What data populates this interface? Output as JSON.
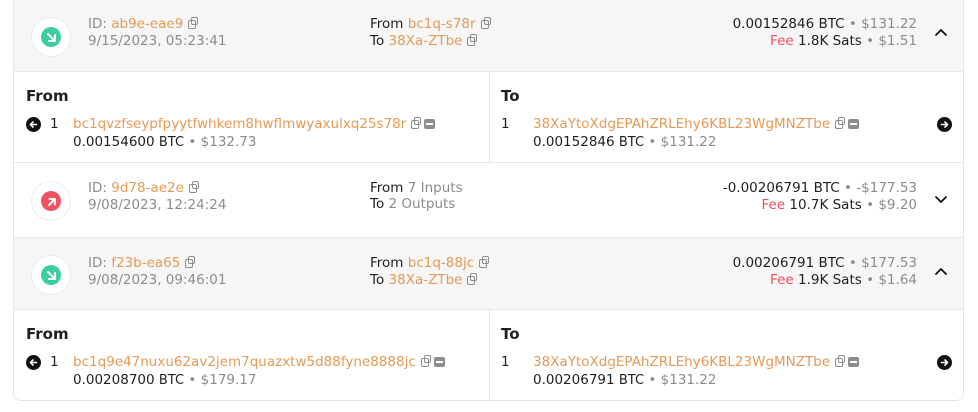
{
  "transactions": [
    {
      "id_label": "ID:",
      "id": "ab9e-eae9",
      "date": "9/15/2023, 05:23:41",
      "direction": "incoming",
      "from_label": "From",
      "from": "bc1q-s78r",
      "to_label": "To",
      "to": "38Xa-ZTbe",
      "amount": "0.00152846 BTC",
      "amount_usd": "$131.22",
      "fee_label": "Fee",
      "fee_sats": "1.8K Sats",
      "fee_usd": "$1.51",
      "expanded": true,
      "detail": {
        "from_heading": "From",
        "to_heading": "To",
        "inputs": [
          {
            "index": "1",
            "address": "bc1qvzfseypfpyytfwhkem8hwflmwyaxulxq25s78r",
            "btc": "0.00154600",
            "unit": "BTC",
            "usd": "$132.73"
          }
        ],
        "outputs": [
          {
            "index": "1",
            "address": "38XaYtoXdgEPAhZRLEhy6KBL23WgMNZTbe",
            "btc": "0.00152846",
            "unit": "BTC",
            "usd": "$131.22"
          }
        ]
      }
    },
    {
      "id_label": "ID:",
      "id": "9d78-ae2e",
      "date": "9/08/2023, 12:24:24",
      "direction": "outgoing",
      "from_label": "From",
      "from": "7 Inputs",
      "to_label": "To",
      "to": "2 Outputs",
      "amount": "-0.00206791 BTC",
      "amount_usd": "-$177.53",
      "fee_label": "Fee",
      "fee_sats": "10.7K Sats",
      "fee_usd": "$9.20",
      "expanded": false
    },
    {
      "id_label": "ID:",
      "id": "f23b-ea65",
      "date": "9/08/2023, 09:46:01",
      "direction": "incoming",
      "from_label": "From",
      "from": "bc1q-88jc",
      "to_label": "To",
      "to": "38Xa-ZTbe",
      "amount": "0.00206791 BTC",
      "amount_usd": "$177.53",
      "fee_label": "Fee",
      "fee_sats": "1.9K Sats",
      "fee_usd": "$1.64",
      "expanded": true,
      "detail": {
        "from_heading": "From",
        "to_heading": "To",
        "inputs": [
          {
            "index": "1",
            "address": "bc1q9e47nuxu62av2jem7quazxtw5d88fyne8888jc",
            "btc": "0.00208700",
            "unit": "BTC",
            "usd": "$179.17"
          }
        ],
        "outputs": [
          {
            "index": "1",
            "address": "38XaYtoXdgEPAhZRLEhy6KBL23WgMNZTbe",
            "btc": "0.00206791",
            "unit": "BTC",
            "usd": "$131.22"
          }
        ]
      }
    }
  ],
  "colors": {
    "incoming": "#3ccf9b",
    "outgoing": "#ef5263",
    "link": "#e59a55",
    "fee": "#ef4e5e"
  },
  "icons": [
    "arrow-in-icon",
    "arrow-out-icon",
    "copy-icon",
    "wallet-icon",
    "chevron-up-icon",
    "chevron-down-icon",
    "arrow-left-circle-icon",
    "arrow-right-circle-icon"
  ]
}
